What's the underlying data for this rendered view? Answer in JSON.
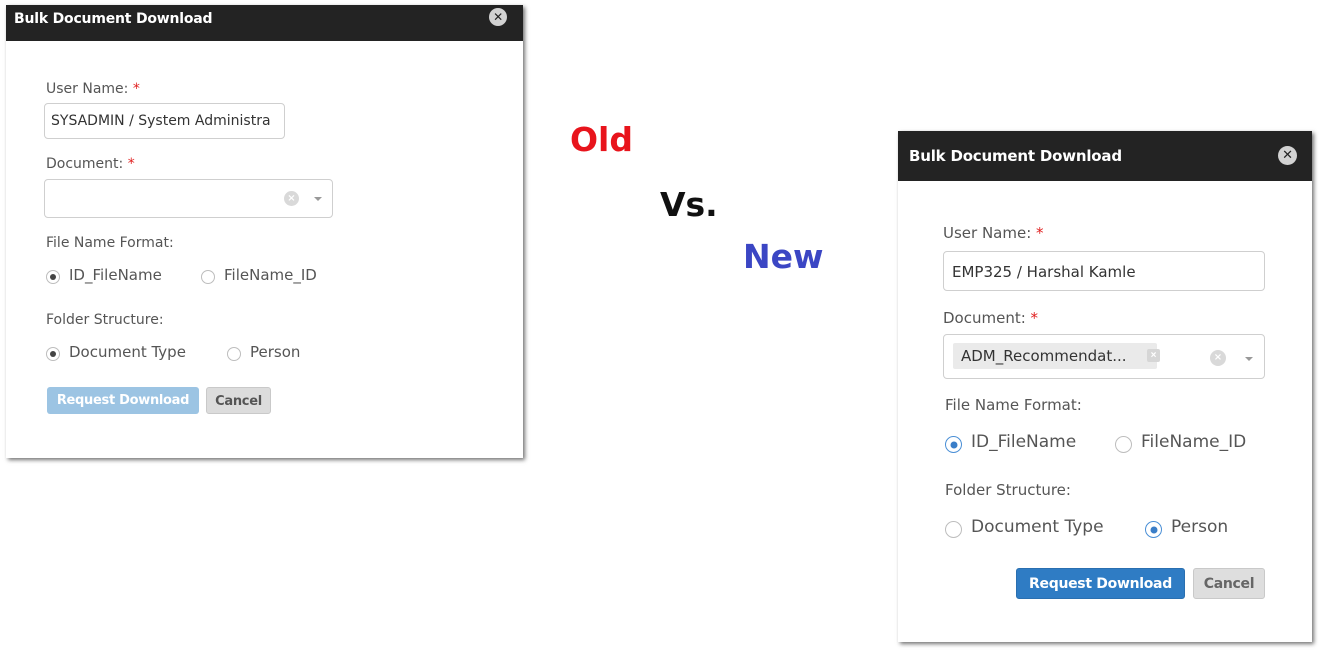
{
  "old_dialog": {
    "title": "Bulk Document Download",
    "close_glyph": "✕",
    "user_name": {
      "label": "User Name:",
      "required_mark": "*",
      "value": "SYSADMIN / System Administra"
    },
    "document": {
      "label": "Document:",
      "required_mark": "*",
      "selected": "",
      "clear_glyph": "×"
    },
    "file_name_format": {
      "label": "File Name Format:",
      "options": [
        {
          "label": "ID_FileName",
          "checked": true
        },
        {
          "label": "FileName_ID",
          "checked": false
        }
      ]
    },
    "folder_structure": {
      "label": "Folder Structure:",
      "options": [
        {
          "label": "Document Type",
          "checked": true
        },
        {
          "label": "Person",
          "checked": false
        }
      ]
    },
    "request_button": "Request Download",
    "cancel_button": "Cancel",
    "request_button_state": "disabled"
  },
  "comparison": {
    "old_label": "Old",
    "vs_label": "Vs.",
    "new_label": "New",
    "old_color": "#e8141c",
    "vs_color": "#111111",
    "new_color": "#3b46c4"
  },
  "new_dialog": {
    "title": "Bulk Document Download",
    "close_glyph": "✕",
    "user_name": {
      "label": "User Name:",
      "required_mark": "*",
      "value": "EMP325 / Harshal Kamle"
    },
    "document": {
      "label": "Document:",
      "required_mark": "*",
      "selected": "ADM_Recommendat...",
      "tag_remove_glyph": "×",
      "clear_glyph": "×"
    },
    "file_name_format": {
      "label": "File Name Format:",
      "options": [
        {
          "label": "ID_FileName",
          "checked": true
        },
        {
          "label": "FileName_ID",
          "checked": false
        }
      ]
    },
    "folder_structure": {
      "label": "Folder Structure:",
      "options": [
        {
          "label": "Document Type",
          "checked": false
        },
        {
          "label": "Person",
          "checked": true
        }
      ]
    },
    "request_button": "Request Download",
    "cancel_button": "Cancel",
    "request_button_state": "enabled"
  },
  "colors": {
    "header_bg": "#232323",
    "required": "#e02020",
    "primary_button": "#2f7cc4",
    "primary_button_disabled": "#9cc4e3"
  }
}
